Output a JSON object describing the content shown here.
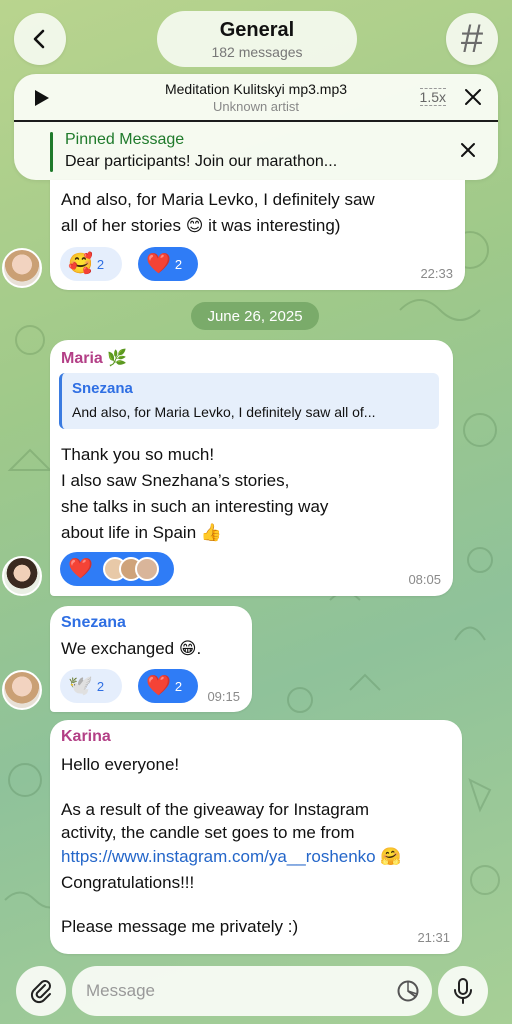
{
  "header": {
    "title": "General",
    "subtitle": "182 messages",
    "hash_symbol": "#"
  },
  "player": {
    "track": "Meditation Kulitskyi mp3.mp3",
    "artist": "Unknown artist",
    "speed": "1.5x"
  },
  "pinned": {
    "title": "Pinned Message",
    "text": "Dear participants! Join our marathon..."
  },
  "messages": [
    {
      "lines": [
        "And also, for Maria Levko, I definitely saw",
        "all of her stories 😊  it was interesting)"
      ],
      "reactions": [
        {
          "emoji": "🥰",
          "count": "2",
          "style": "light"
        },
        {
          "emoji": "❤️",
          "count": "2",
          "style": "dark"
        }
      ],
      "time": "22:33"
    },
    {
      "sender": "Maria",
      "sender_emoji": "🌿",
      "sender_color": "#b33f86",
      "reply": {
        "name": "Snezana",
        "text": "And also, for Maria Levko, I definitely saw all of..."
      },
      "lines": [
        "Thank you so much!",
        "I also saw Snezhana’s stories,",
        "she talks in such an interesting way",
        "about life in Spain 👍"
      ],
      "reactions": [
        {
          "emoji": "❤️",
          "style": "dark"
        }
      ],
      "time": "08:05"
    },
    {
      "sender": "Snezana",
      "sender_color": "#2f6fe3",
      "lines": [
        "We exchanged 😁."
      ],
      "reactions": [
        {
          "emoji": "🕊️",
          "count": "2",
          "style": "light"
        },
        {
          "emoji": "❤️",
          "count": "2",
          "style": "dark"
        }
      ],
      "time": "09:15"
    },
    {
      "sender": "Karina",
      "sender_color": "#b33f86",
      "lines": [
        "Hello everyone!",
        "",
        "As a result of the giveaway for Instagram",
        "activity, the candle set goes to me from"
      ],
      "link": "https://www.instagram.com/ya__roshenko",
      "link_emoji": "🤗",
      "lines_after": [
        "Congratulations!!!",
        "",
        "Please message me privately :)"
      ],
      "time": "21:31"
    }
  ],
  "date_separator": "June 26, 2025",
  "composer": {
    "placeholder": "Message"
  },
  "colors": {
    "accent_blue": "#2f7cf6",
    "pinned_green": "#1f7a2b",
    "background_green": "#a7cf96"
  },
  "icons": [
    "back-arrow-icon",
    "hash-icon",
    "play-icon",
    "close-icon",
    "paperclip-icon",
    "sticker-icon",
    "microphone-icon"
  ]
}
